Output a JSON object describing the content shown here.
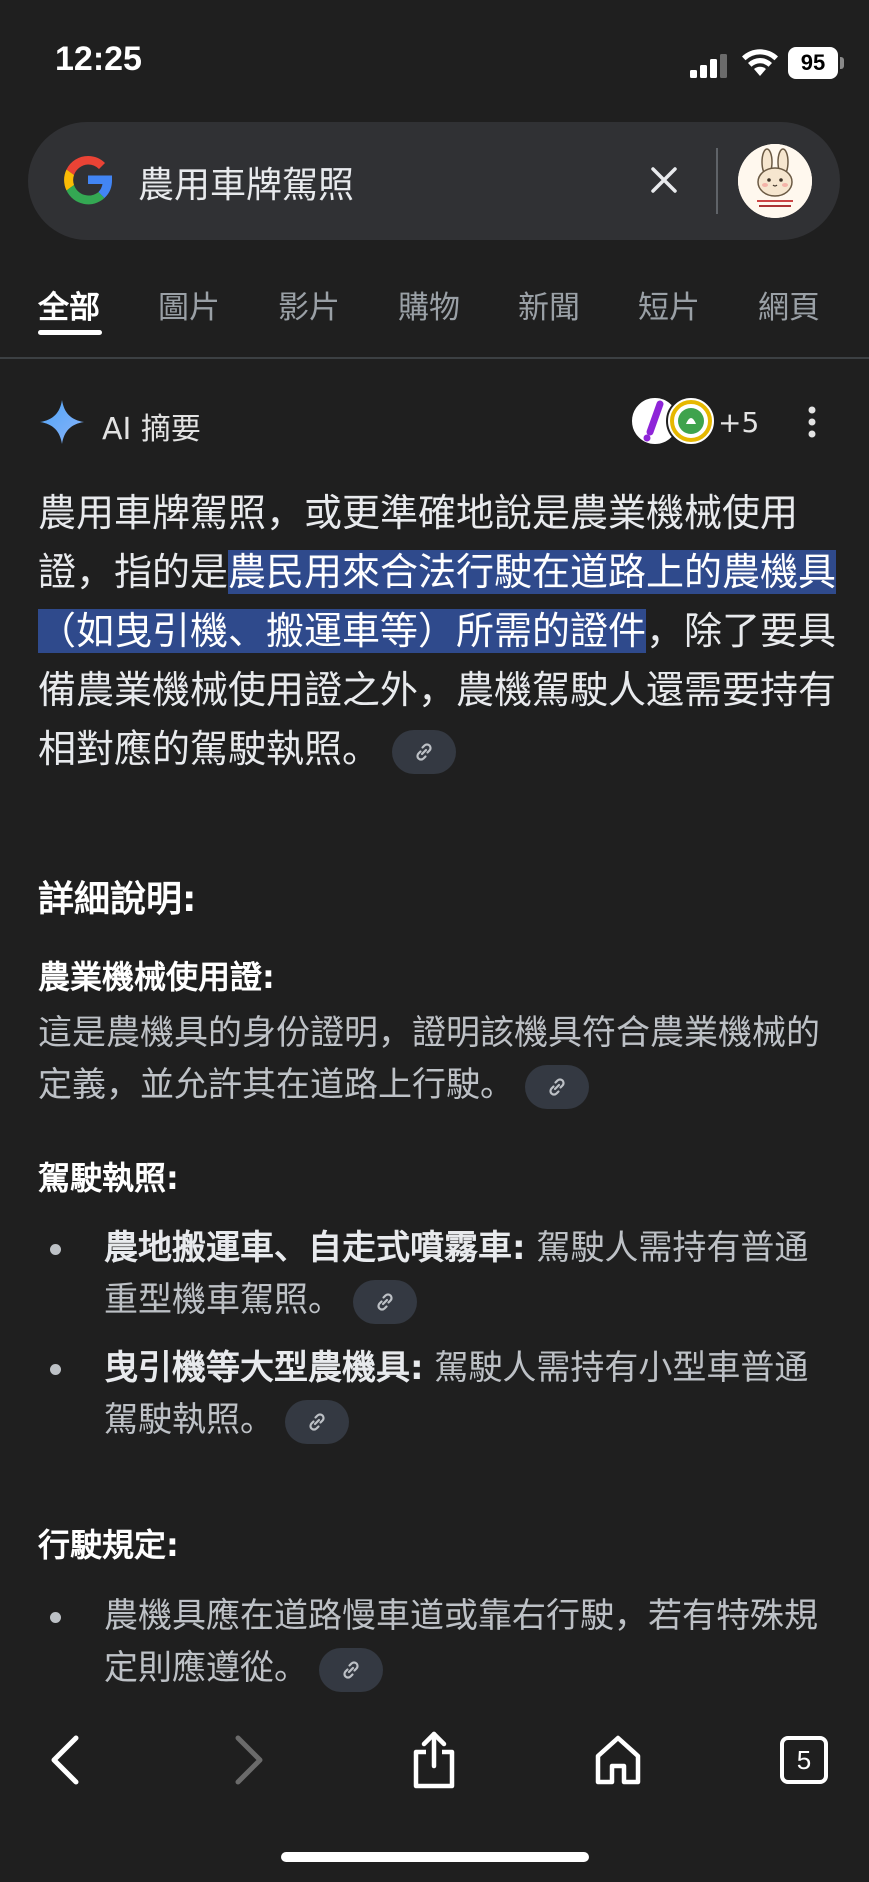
{
  "status_bar": {
    "time": "12:25",
    "battery": "95"
  },
  "search": {
    "query": "農用車牌駕照"
  },
  "tabs": [
    {
      "label": "全部"
    },
    {
      "label": "圖片"
    },
    {
      "label": "影片"
    },
    {
      "label": "購物"
    },
    {
      "label": "新聞"
    },
    {
      "label": "短片"
    },
    {
      "label": "網頁"
    }
  ],
  "ai_overview": {
    "title": "AI 摘要",
    "sources_more": "+5",
    "summary_pre": "農用車牌駕照，或更準確地說是農業機械使用證，指的是",
    "summary_highlight": "農民用來合法行駛在道路上的農機具（如曳引機、搬運車等）所需的證件",
    "summary_post": "，除了要具備農業機械使用證之外，農機駕駛人還需要持有相對應的駕駛執照。",
    "details_heading": "詳細說明:",
    "section1": {
      "heading": "農業機械使用證:",
      "text": "這是農機具的身份證明，證明該機具符合農業機械的定義，並允許其在道路上行駛。"
    },
    "section2": {
      "heading": "駕駛執照:",
      "items": [
        {
          "bold": "農地搬運車、自走式噴霧車:",
          "text": " 駕駛人需持有普通重型機車駕照。"
        },
        {
          "bold": "曳引機等大型農機具:",
          "text": " 駕駛人需持有小型車普通駕駛執照。"
        }
      ]
    },
    "section3": {
      "heading": "行駛規定:",
      "items": [
        {
          "text": "農機具應在道路慢車道或靠右行駛，若有特殊規定則應遵從。"
        }
      ]
    }
  },
  "bottom_nav": {
    "tab_count": "5"
  }
}
